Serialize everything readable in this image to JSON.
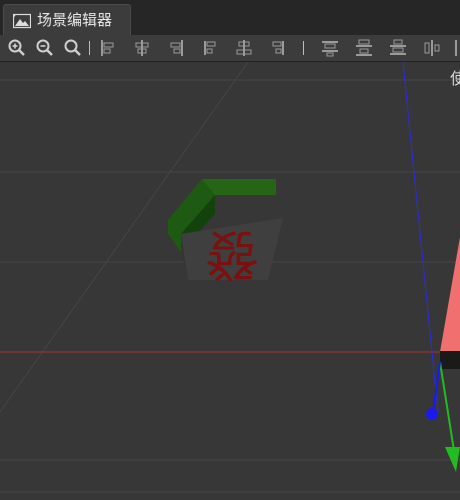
{
  "window": {
    "tab_title": "场景编辑器",
    "tab_icon": "scene-image-icon"
  },
  "toolbar": {
    "buttons": [
      {
        "name": "zoom-in",
        "icon": "zoom-in-icon"
      },
      {
        "name": "zoom-out",
        "icon": "zoom-out-icon"
      },
      {
        "name": "zoom-reset",
        "icon": "zoom-reset-icon"
      },
      {
        "name": "align-left",
        "icon": "align-left-icon"
      },
      {
        "name": "align-horizontal-center",
        "icon": "align-horizontal-center-icon"
      },
      {
        "name": "align-right",
        "icon": "align-right-icon"
      },
      {
        "name": "align-top",
        "icon": "align-top-icon"
      },
      {
        "name": "align-vertical-center",
        "icon": "align-vertical-center-icon"
      },
      {
        "name": "align-bottom",
        "icon": "align-bottom-icon"
      },
      {
        "name": "distribute-top",
        "icon": "distribute-top-icon"
      },
      {
        "name": "distribute-vertical-center",
        "icon": "distribute-vertical-center-icon"
      },
      {
        "name": "distribute-bottom",
        "icon": "distribute-bottom-icon"
      },
      {
        "name": "distribute-left",
        "icon": "distribute-left-icon"
      }
    ]
  },
  "viewport": {
    "corner_label": "使",
    "tile_glyph": "發",
    "colors": {
      "background": "#373737",
      "grid": "#454545",
      "x_axis": "#a83232",
      "y_axis": "#2d2dc8",
      "tile_green": "#1f5a12",
      "tile_face": "#3f3f3f",
      "glyph_red": "#7a1010",
      "gizmo_red": "#f07070",
      "gizmo_green": "#22bb22",
      "gizmo_blue": "#1a1aee"
    }
  }
}
